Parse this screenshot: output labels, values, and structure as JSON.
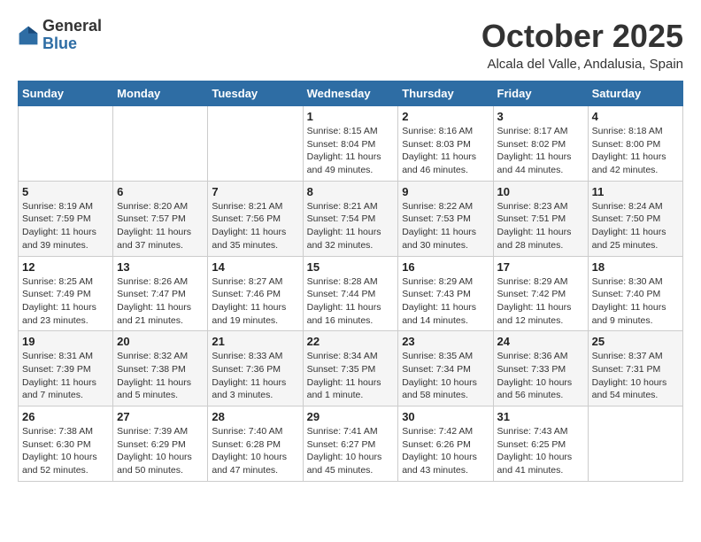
{
  "header": {
    "logo_general": "General",
    "logo_blue": "Blue",
    "month_title": "October 2025",
    "location": "Alcala del Valle, Andalusia, Spain"
  },
  "days_of_week": [
    "Sunday",
    "Monday",
    "Tuesday",
    "Wednesday",
    "Thursday",
    "Friday",
    "Saturday"
  ],
  "weeks": [
    [
      {
        "day": "",
        "info": ""
      },
      {
        "day": "",
        "info": ""
      },
      {
        "day": "",
        "info": ""
      },
      {
        "day": "1",
        "info": "Sunrise: 8:15 AM\nSunset: 8:04 PM\nDaylight: 11 hours\nand 49 minutes."
      },
      {
        "day": "2",
        "info": "Sunrise: 8:16 AM\nSunset: 8:03 PM\nDaylight: 11 hours\nand 46 minutes."
      },
      {
        "day": "3",
        "info": "Sunrise: 8:17 AM\nSunset: 8:02 PM\nDaylight: 11 hours\nand 44 minutes."
      },
      {
        "day": "4",
        "info": "Sunrise: 8:18 AM\nSunset: 8:00 PM\nDaylight: 11 hours\nand 42 minutes."
      }
    ],
    [
      {
        "day": "5",
        "info": "Sunrise: 8:19 AM\nSunset: 7:59 PM\nDaylight: 11 hours\nand 39 minutes."
      },
      {
        "day": "6",
        "info": "Sunrise: 8:20 AM\nSunset: 7:57 PM\nDaylight: 11 hours\nand 37 minutes."
      },
      {
        "day": "7",
        "info": "Sunrise: 8:21 AM\nSunset: 7:56 PM\nDaylight: 11 hours\nand 35 minutes."
      },
      {
        "day": "8",
        "info": "Sunrise: 8:21 AM\nSunset: 7:54 PM\nDaylight: 11 hours\nand 32 minutes."
      },
      {
        "day": "9",
        "info": "Sunrise: 8:22 AM\nSunset: 7:53 PM\nDaylight: 11 hours\nand 30 minutes."
      },
      {
        "day": "10",
        "info": "Sunrise: 8:23 AM\nSunset: 7:51 PM\nDaylight: 11 hours\nand 28 minutes."
      },
      {
        "day": "11",
        "info": "Sunrise: 8:24 AM\nSunset: 7:50 PM\nDaylight: 11 hours\nand 25 minutes."
      }
    ],
    [
      {
        "day": "12",
        "info": "Sunrise: 8:25 AM\nSunset: 7:49 PM\nDaylight: 11 hours\nand 23 minutes."
      },
      {
        "day": "13",
        "info": "Sunrise: 8:26 AM\nSunset: 7:47 PM\nDaylight: 11 hours\nand 21 minutes."
      },
      {
        "day": "14",
        "info": "Sunrise: 8:27 AM\nSunset: 7:46 PM\nDaylight: 11 hours\nand 19 minutes."
      },
      {
        "day": "15",
        "info": "Sunrise: 8:28 AM\nSunset: 7:44 PM\nDaylight: 11 hours\nand 16 minutes."
      },
      {
        "day": "16",
        "info": "Sunrise: 8:29 AM\nSunset: 7:43 PM\nDaylight: 11 hours\nand 14 minutes."
      },
      {
        "day": "17",
        "info": "Sunrise: 8:29 AM\nSunset: 7:42 PM\nDaylight: 11 hours\nand 12 minutes."
      },
      {
        "day": "18",
        "info": "Sunrise: 8:30 AM\nSunset: 7:40 PM\nDaylight: 11 hours\nand 9 minutes."
      }
    ],
    [
      {
        "day": "19",
        "info": "Sunrise: 8:31 AM\nSunset: 7:39 PM\nDaylight: 11 hours\nand 7 minutes."
      },
      {
        "day": "20",
        "info": "Sunrise: 8:32 AM\nSunset: 7:38 PM\nDaylight: 11 hours\nand 5 minutes."
      },
      {
        "day": "21",
        "info": "Sunrise: 8:33 AM\nSunset: 7:36 PM\nDaylight: 11 hours\nand 3 minutes."
      },
      {
        "day": "22",
        "info": "Sunrise: 8:34 AM\nSunset: 7:35 PM\nDaylight: 11 hours\nand 1 minute."
      },
      {
        "day": "23",
        "info": "Sunrise: 8:35 AM\nSunset: 7:34 PM\nDaylight: 10 hours\nand 58 minutes."
      },
      {
        "day": "24",
        "info": "Sunrise: 8:36 AM\nSunset: 7:33 PM\nDaylight: 10 hours\nand 56 minutes."
      },
      {
        "day": "25",
        "info": "Sunrise: 8:37 AM\nSunset: 7:31 PM\nDaylight: 10 hours\nand 54 minutes."
      }
    ],
    [
      {
        "day": "26",
        "info": "Sunrise: 7:38 AM\nSunset: 6:30 PM\nDaylight: 10 hours\nand 52 minutes."
      },
      {
        "day": "27",
        "info": "Sunrise: 7:39 AM\nSunset: 6:29 PM\nDaylight: 10 hours\nand 50 minutes."
      },
      {
        "day": "28",
        "info": "Sunrise: 7:40 AM\nSunset: 6:28 PM\nDaylight: 10 hours\nand 47 minutes."
      },
      {
        "day": "29",
        "info": "Sunrise: 7:41 AM\nSunset: 6:27 PM\nDaylight: 10 hours\nand 45 minutes."
      },
      {
        "day": "30",
        "info": "Sunrise: 7:42 AM\nSunset: 6:26 PM\nDaylight: 10 hours\nand 43 minutes."
      },
      {
        "day": "31",
        "info": "Sunrise: 7:43 AM\nSunset: 6:25 PM\nDaylight: 10 hours\nand 41 minutes."
      },
      {
        "day": "",
        "info": ""
      }
    ]
  ]
}
